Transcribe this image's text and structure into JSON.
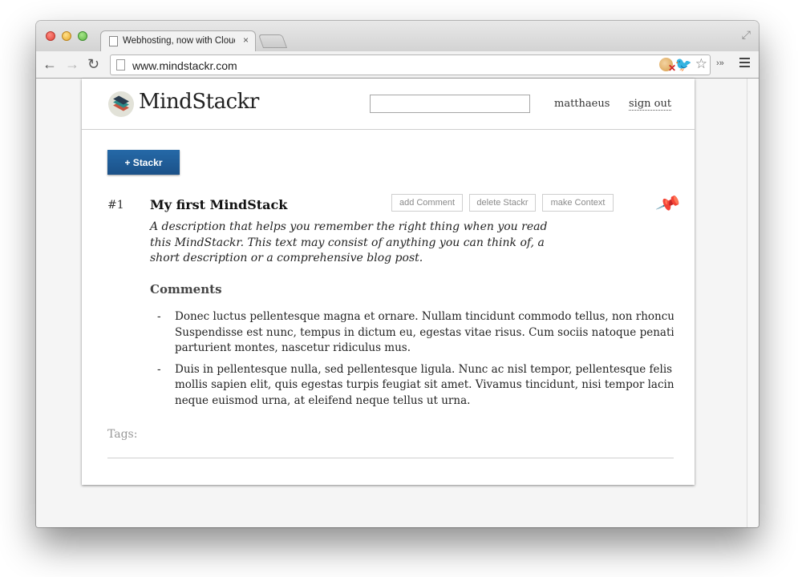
{
  "browser": {
    "tab_title": "Webhosting, now with Cloud",
    "tab_close": "×",
    "url": "www.mindstackr.com",
    "more_label": "›»"
  },
  "site": {
    "logo_text": "MindStackr",
    "search_placeholder": "",
    "username": "matthaeus",
    "signout_label": "sign out",
    "add_button_label": "+ Stackr"
  },
  "stack": {
    "number": "#1",
    "title": "My first MindStack",
    "actions": [
      "add Comment",
      "delete Stackr",
      "make Context"
    ],
    "description_lines": [
      "A description that helps you remember the right thing when you read",
      "this MindStackr. This text may consist of anything you can think of, a",
      "short description or a comprehensive blog post."
    ],
    "comments_heading": "Comments",
    "comments": [
      {
        "dash": "-",
        "lines": [
          "Donec luctus pellentesque magna et ornare. Nullam tincidunt commodo tellus, non rhoncus",
          "Suspendisse est nunc, tempus in dictum eu, egestas vitae risus. Cum sociis natoque penatibus",
          "parturient montes, nascetur ridiculus mus."
        ]
      },
      {
        "dash": "-",
        "lines": [
          "Duis in pellentesque nulla, sed pellentesque ligula. Nunc ac nisl tempor, pellentesque felis",
          "mollis sapien elit, quis egestas turpis feugiat sit amet. Vivamus tincidunt, nisi tempor lacinia",
          "neque euismod urna, at eleifend neque tellus ut urna."
        ]
      }
    ],
    "tags_label": "Tags:"
  },
  "colors": {
    "primary_button": "#1f5b98",
    "page_background": "#f5f5f5"
  },
  "icons": {
    "tab": "page-icon",
    "back": "arrow-left-icon",
    "forward": "arrow-right-icon",
    "reload": "reload-icon",
    "bookmark": "star-icon",
    "menu": "hamburger-menu-icon",
    "pin": "pushpin-icon",
    "logo": "stacked-layers-icon"
  }
}
